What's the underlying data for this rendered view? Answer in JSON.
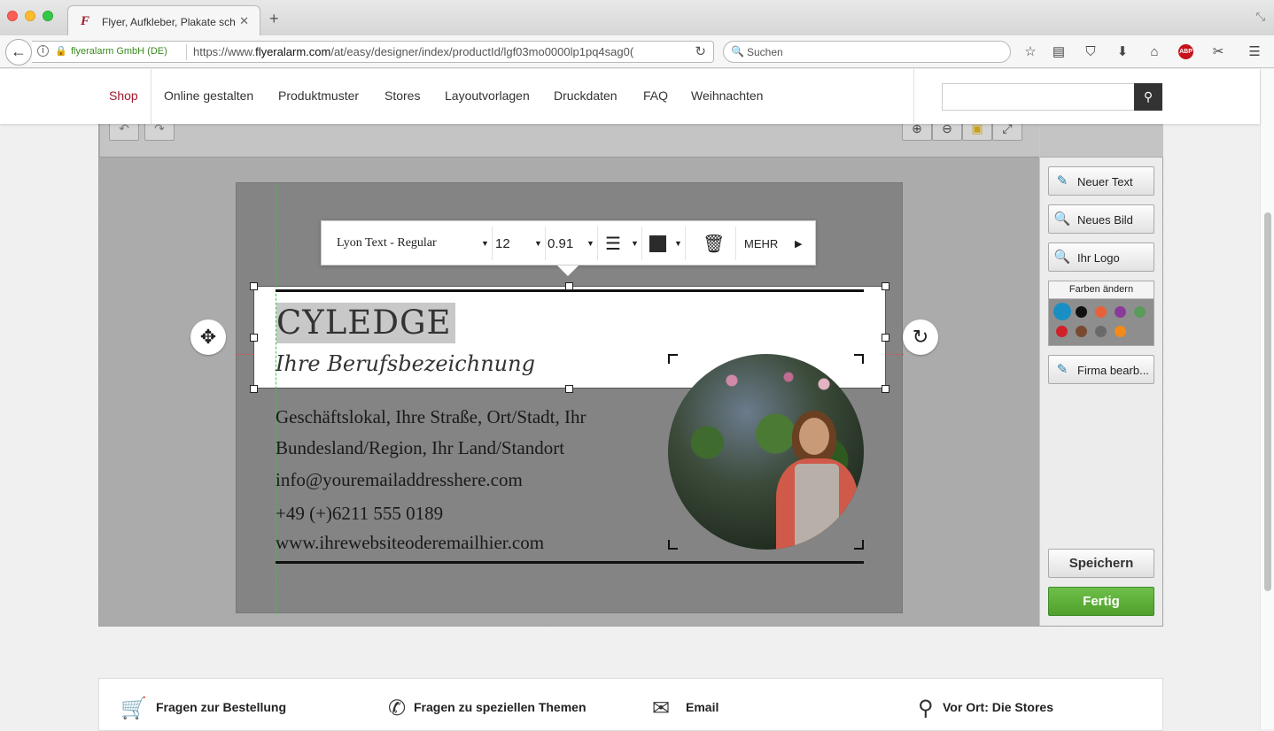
{
  "browser": {
    "tab_title": "Flyer, Aufkleber, Plakate sch",
    "tab_favicon": "F",
    "url_org": "flyeralarm GmbH (DE)",
    "url_prefix": "https://www.",
    "url_domain": "flyeralarm.com",
    "url_path": "/at/easy/designer/index/productId/lgf03mo0000lp1pq4sag0(",
    "search_placeholder": "Suchen"
  },
  "site_nav": {
    "items": [
      "Shop",
      "Online gestalten",
      "Produktmuster",
      "Stores",
      "Layoutvorlagen",
      "Druckdaten",
      "FAQ",
      "Weihnachten"
    ],
    "active_color": "#a3192c"
  },
  "text_toolbar": {
    "font": "Lyon Text - Regular",
    "size": "12",
    "line_height": "0.91",
    "color": "#2b2b2b",
    "more_label": "MEHR"
  },
  "card": {
    "name": "CYLEDGE",
    "job_title": "Ihre Berufsbezeichnung",
    "address_line1": "Geschäftslokal, Ihre Straße, Ort/Stadt, Ihr",
    "address_line2": "Bundesland/Region, Ihr Land/Standort",
    "email": "info@youremailaddresshere.com",
    "phone": "+49 (+)6211 555 0189",
    "website": "www.ihrewebsiteoderemailhier.com"
  },
  "right_panel": {
    "new_text": "Neuer Text",
    "new_image": "Neues Bild",
    "logo": "Ihr Logo",
    "colors_title": "Farben ändern",
    "edit_company": "Firma bearb...",
    "save": "Speichern",
    "done": "Fertig",
    "swatches": [
      "#1a8fc4",
      "#111111",
      "#e8613a",
      "#8b3a9a",
      "#5a9a5a",
      "#d0202a",
      "#7a4a30",
      "#6a6a6a",
      "#f08a1a"
    ]
  },
  "help_bar": {
    "order": "Fragen zur Bestellung",
    "topics": "Fragen zu speziellen Themen",
    "email": "Email",
    "stores": "Vor Ort: Die Stores"
  }
}
